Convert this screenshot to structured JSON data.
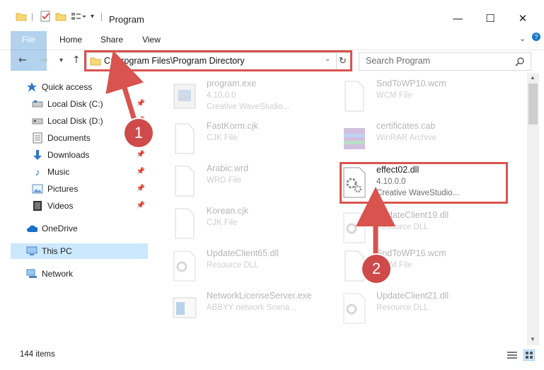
{
  "window": {
    "title": "Program"
  },
  "ribbon": {
    "tabs": [
      "File",
      "Home",
      "Share",
      "View"
    ]
  },
  "address": {
    "path": "C:\\Program Files\\Program Directory"
  },
  "search": {
    "placeholder": "Search Program"
  },
  "sidebar": {
    "items": [
      {
        "label": "Quick access",
        "icon": "star-icon"
      },
      {
        "label": "Local Disk (C:)",
        "icon": "drive-icon"
      },
      {
        "label": "Local Disk (D:)",
        "icon": "drive-icon"
      },
      {
        "label": "Documents",
        "icon": "documents-icon"
      },
      {
        "label": "Downloads",
        "icon": "download-icon"
      },
      {
        "label": "Music",
        "icon": "music-icon"
      },
      {
        "label": "Pictures",
        "icon": "pictures-icon"
      },
      {
        "label": "Videos",
        "icon": "videos-icon"
      },
      {
        "label": "OneDrive",
        "icon": "cloud-icon"
      },
      {
        "label": "This PC",
        "icon": "computer-icon"
      },
      {
        "label": "Network",
        "icon": "network-icon"
      }
    ]
  },
  "files": [
    {
      "name": "program.exe",
      "type": "4.10.0.0",
      "extra": "Creative WaveStudio..."
    },
    {
      "name": "SndToWP10.wcm",
      "type": "WCM File",
      "extra": ""
    },
    {
      "name": "FastKorm.cjk",
      "type": "CJK File",
      "extra": ""
    },
    {
      "name": "certificates.cab",
      "type": "WinRAR Archive",
      "extra": ""
    },
    {
      "name": "Arabic.wrd",
      "type": "WRD File",
      "extra": ""
    },
    {
      "name": "effect02.dll",
      "type": "4.10.0.0",
      "extra": "Creative WaveStudio..."
    },
    {
      "name": "Korean.cjk",
      "type": "CJK File",
      "extra": ""
    },
    {
      "name": "UpdateClient19.dll",
      "type": "Resource DLL",
      "extra": ""
    },
    {
      "name": "UpdateClient65.dll",
      "type": "Resource DLL",
      "extra": ""
    },
    {
      "name": "SndToWP16.wcm",
      "type": "WCM File",
      "extra": ""
    },
    {
      "name": "NetworkLicenseServer.exe",
      "type": "ABBYY network Scena...",
      "extra": ""
    },
    {
      "name": "UpdateClient21.dll",
      "type": "Resource DLL",
      "extra": ""
    }
  ],
  "status": {
    "count": "144 items"
  },
  "annotations": {
    "badge1": "1",
    "badge2": "2",
    "color": "#d9534f"
  }
}
